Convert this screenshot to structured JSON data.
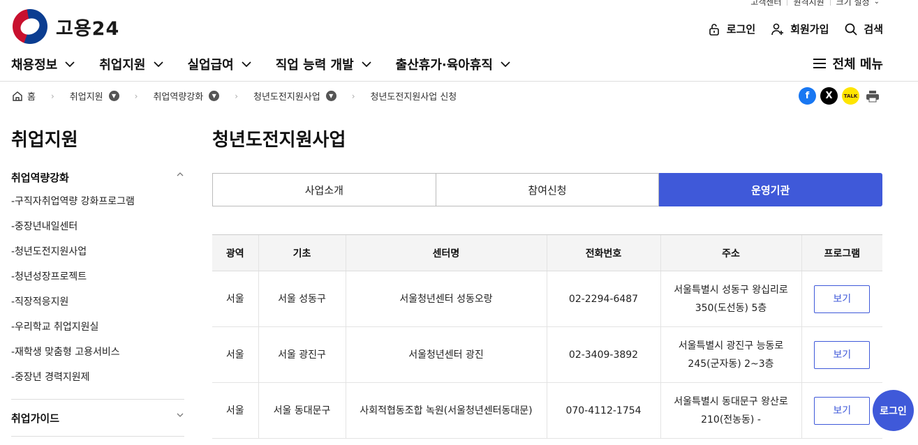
{
  "utility": {
    "items": [
      "고객센터",
      "원격지원",
      "크기 설정"
    ]
  },
  "logo": {
    "text": "고용24"
  },
  "topActions": {
    "login": "로그인",
    "join": "회원가입",
    "search": "검색"
  },
  "gnb": {
    "menus": [
      "채용정보",
      "취업지원",
      "실업급여",
      "직업 능력 개발",
      "출산휴가·육아휴직"
    ],
    "all": "전체 메뉴"
  },
  "breadcrumb": {
    "home": "홈",
    "items": [
      "취업지원",
      "취업역량강화",
      "청년도전지원사업",
      "청년도전지원사업 신청"
    ]
  },
  "sidebar": {
    "title": "취업지원",
    "group": "취업역량강화",
    "items": [
      "-구직자취업역량 강화프로그램",
      "-중장년내일센터",
      "-청년도전지원사업",
      "-청년성장프로젝트",
      "-직장적응지원",
      "-우리학교 취업지원실",
      "-재학생 맞춤형 고용서비스",
      "-중장년 경력지원제"
    ],
    "group2": "취업가이드"
  },
  "main": {
    "title": "청년도전지원사업",
    "tabs": [
      "사업소개",
      "참여신청",
      "운영기관"
    ],
    "activeTab": "운영기관"
  },
  "table": {
    "headers": [
      "광역",
      "기초",
      "센터명",
      "전화번호",
      "주소",
      "프로그램"
    ],
    "rows": [
      {
        "region": "서울",
        "district": "서울 성동구",
        "center": "서울청년센터 성동오랑",
        "phone": "02-2294-6487",
        "addr1": "서울특별시 성동구 왕십리로",
        "addr2": "350(도선동) 5층",
        "btn": "보기"
      },
      {
        "region": "서울",
        "district": "서울 광진구",
        "center": "서울청년센터 광진",
        "phone": "02-3409-3892",
        "addr1": "서울특별시 광진구 능동로",
        "addr2": "245(군자동) 2~3층",
        "btn": "보기"
      },
      {
        "region": "서울",
        "district": "서울 동대문구",
        "center": "사회적협동조합 녹원(서울청년센터동대문)",
        "phone": "070-4112-1754",
        "addr1": "서울특별시 동대문구 왕산로",
        "addr2": "210(전농동) -",
        "btn": "보기"
      }
    ]
  },
  "floatLogin": "로그인",
  "colors": {
    "accent": "#3f59d9",
    "brandRed": "#c8102e",
    "brandBlue": "#0b3d91"
  },
  "share": {
    "kakao": "TALK"
  }
}
